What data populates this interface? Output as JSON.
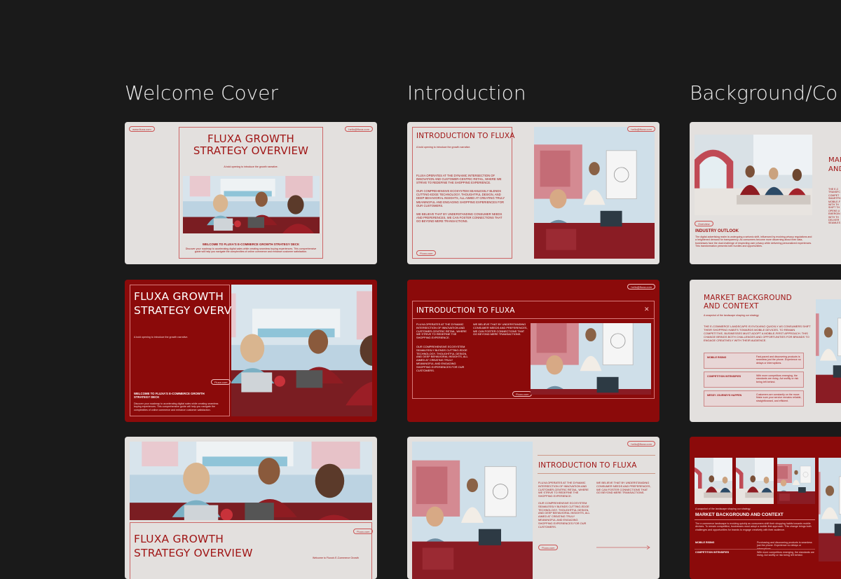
{
  "columns": [
    {
      "title": "Welcome Cover"
    },
    {
      "title": "Introduction"
    },
    {
      "title": "Background/Co"
    }
  ],
  "common": {
    "website": "www.fluxa.com",
    "email": "hello@fluxa.com",
    "tagline": "A bold opening to introduce the growth narrative.",
    "fluxa_com": "Fluxa.com",
    "overview_pill": "Overview"
  },
  "cover": {
    "title_line1": "FLUXA GROWTH",
    "title_line2": "STRATEGY OVERVIEW",
    "welcome_heading": "WELCOME TO FLUXA'S E-COMMERCE GROWTH STRATEGY DECK",
    "welcome_line1": "WELCOME TO FLUXA'S E-COMMERCE GROWTH",
    "welcome_line2": "STRATEGY DECK",
    "welcome_body": "Discover your roadmap to accelerating digital sales while creating seamless buying experiences. This comprehensive guide will help you navigate the complexities of online commerce and enhance customer satisfaction.",
    "footer_welcome": "Welcome to Fluxa's E-Commerce Growth"
  },
  "intro": {
    "title": "INTRODUCTION TO FLUXA",
    "para1": "FLUXA OPERATES AT THE DYNAMIC INTERSECTION OF INNOVATION AND CUSTOMER-CENTRIC RETAIL, WHERE WE STRIVE TO REDEFINE THE SHOPPING EXPERIENCE.",
    "para2": "OUR COMPREHENSIVE ECOSYSTEM SEAMLESSLY BLENDS CUTTING-EDGE TECHNOLOGY, THOUGHTFUL DESIGN, AND DEEP BEHAVIORAL INSIGHTS, ALL AIMED AT CREATING TRULY MEANINGFUL AND ENGAGING SHOPPING EXPERIENCES FOR OUR CUSTOMERS.",
    "para3": "WE BELIEVE THAT BY UNDERSTANDING CONSUMER NEEDS AND PREFERENCES, WE CAN FOSTER CONNECTIONS THAT GO BEYOND MERE TRANSACTIONS.",
    "close_glyph": "✕"
  },
  "background": {
    "outlook_title": "INDUSTRY OUTLOOK",
    "outlook_body": "The digital advertising realm is undergoing a seismic shift, influenced by evolving privacy regulations and a heightened demand for transparency. As consumers become more discerning about their data, businesses face the dual challenge of respecting user privacy while delivering personalized experiences. This transformation presents both hurdles and opportunities.",
    "mar_partial": "MAR",
    "and_partial": "AND",
    "side_text_partial": "THE E-C TRANSFC COMPET SMARTPH MOBILE-F WITH TH SHIFT TH OPENS U EMERGIN WITH TH DELIVER SEAMLES",
    "market_title_line1": "MARKET BACKGROUND",
    "market_title_line2": "AND CONTEXT",
    "market_title": "MARKET BACKGROUND AND CONTEXT",
    "market_sub": "A snapshot of the landscape shaping our strategy",
    "market_body": "THE E-COMMERCE LANDSCAPE IS EVOLVING QUICKLY AS CONSUMERS SHIFT THEIR SHOPPING HABITS TOWARDS MOBILE DEVICES. TO REMAIN COMPETITIVE, BUSINESSES MUST ADOPT A MOBILE-FIRST APPROACH. THIS CHANGE BRINGS BOTH CHALLENGES AND OPPORTUNITIES FOR BRANDS TO ENGAGE CREATIVELY WITH THEIR AUDIENCE.",
    "market_body_small": "The e-commerce landscape is evolving quickly as consumers shift their shopping habits towards mobile devices. To remain competitive, businesses must adopt a mobile-first approach. This change brings both challenges and opportunities for brands to engage creatively with their audience.",
    "table": [
      {
        "label": "MOBILE RISING",
        "desc": "Fast-paced and discovering products is seamless just the phone. Experience no delays or interruptions."
      },
      {
        "label": "COMPETITION INTENSIFIES",
        "desc": "With more competitors emerging, the standards are rising. Act swiftly or risk being left behind."
      },
      {
        "label": "MESSY JOURNEYS HAPPEN",
        "desc": "Customers are constantly on the move. Make sure your service remains reliable, straightforward, and efficient."
      }
    ],
    "small_table_1": "MOBILE RISING",
    "small_table_1_desc": "Purchasing and discovering products is seamless just the phone. Experience no delays or interruptions.",
    "small_table_2": "COMPETITION INTENSIFIES",
    "small_table_2_desc": "With more competitors emerging, the standards are rising. Act swiftly or risk being left behind."
  },
  "colors": {
    "brand_red": "#8b0a0a",
    "accent_red": "#a01616",
    "slide_bg": "#e3e0de",
    "page_bg": "#1a1a1a"
  }
}
